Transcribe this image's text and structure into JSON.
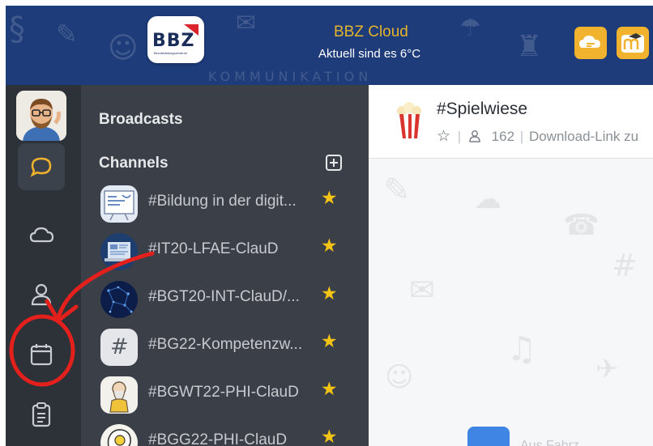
{
  "header": {
    "logo_text": "BBZ",
    "logo_subtext": "Berufsbildungszentrum",
    "app_title": "BBZ Cloud",
    "weather": "Aktuell sind es 6°C",
    "watermark": "KOMMUNIKATION",
    "buttons": [
      {
        "name": "cloud-chat-icon",
        "color": "#f1b32e"
      },
      {
        "name": "moodle-icon",
        "color": "#f1b32e"
      }
    ]
  },
  "rail": {
    "items": [
      {
        "name": "chat-bubble-icon",
        "active": true,
        "accent": "#f1b32e"
      },
      {
        "name": "cloud-icon",
        "active": false
      },
      {
        "name": "user-icon",
        "active": false
      },
      {
        "name": "calendar-icon",
        "active": false
      },
      {
        "name": "clipboard-icon",
        "active": false
      }
    ]
  },
  "panel": {
    "broadcasts_title": "Broadcasts",
    "channels_title": "Channels",
    "channels": [
      {
        "label": "#Bildung in der digit...",
        "starred": true,
        "icon": "whiteboard-thumbnail"
      },
      {
        "label": "#IT20-LFAE-ClauD",
        "starred": true,
        "icon": "laptop-thumbnail"
      },
      {
        "label": "#BGT20-INT-ClauD/...",
        "starred": true,
        "icon": "network-thumbnail"
      },
      {
        "label": "#BG22-Kompetenzw...",
        "starred": true,
        "icon": "hashtag-icon"
      },
      {
        "label": "#BGWT22-PHI-ClauD",
        "starred": true,
        "icon": "philosopher-thumbnail"
      },
      {
        "label": "#BGG22-PHI-ClauD",
        "starred": true,
        "icon": "lightbulb-head-thumbnail"
      }
    ],
    "star_glyph": "★"
  },
  "chat": {
    "title": "#Spielwiese",
    "star_glyph": "☆",
    "member_count": "162",
    "description": "Download-Link zu",
    "separator": "|",
    "message_preview": "Aus Fahrz..."
  },
  "colors": {
    "header_bg": "#1e3c7a",
    "rail_bg": "#2d3138",
    "panel_bg": "#3a3f48",
    "accent": "#f1b32e",
    "star": "#f3c315",
    "annotation": "#e3201b"
  }
}
